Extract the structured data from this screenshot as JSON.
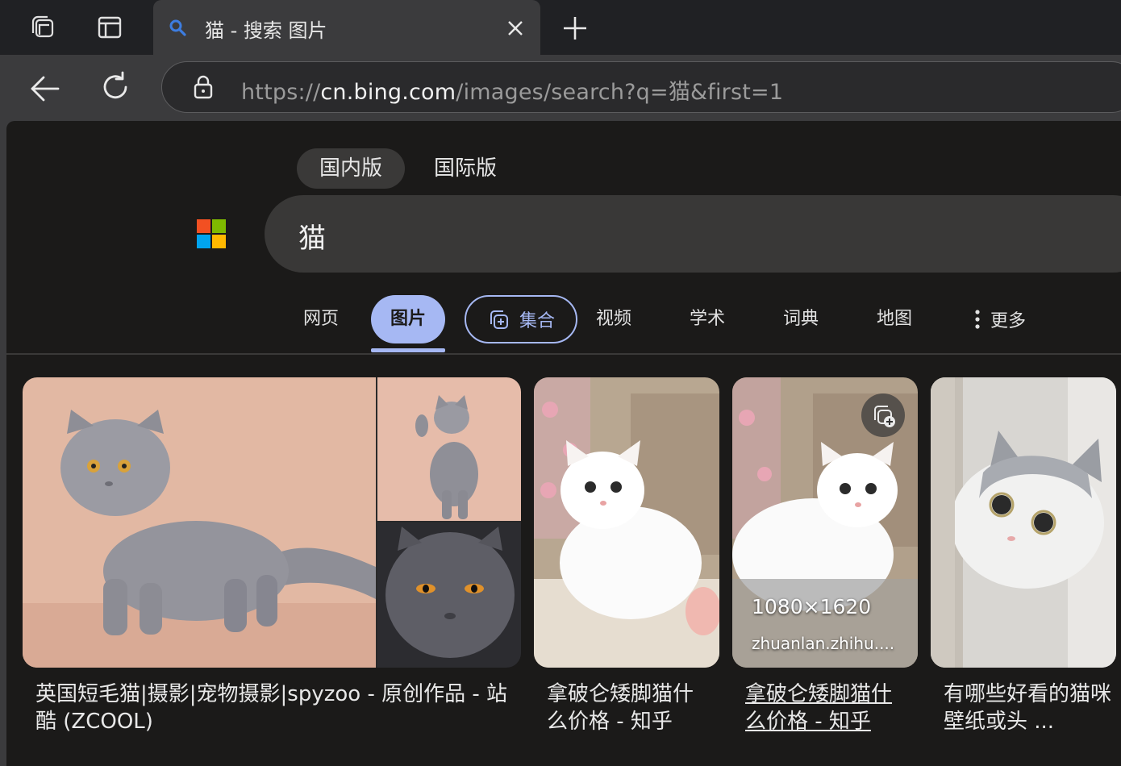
{
  "browser": {
    "tab": {
      "title": "猫 - 搜索 图片"
    },
    "address": {
      "scheme": "https://",
      "host": "cn.bing.com",
      "path": "/images/search?q=猫&first=1"
    }
  },
  "page": {
    "regions": [
      {
        "label": "国内版",
        "active": true
      },
      {
        "label": "国际版",
        "active": false
      }
    ],
    "search": {
      "query": "猫"
    },
    "nav": {
      "web": "网页",
      "images": "图片",
      "collections": "集合",
      "videos": "视频",
      "academic": "学术",
      "dictionary": "词典",
      "maps": "地图",
      "more": "更多"
    },
    "results": [
      {
        "caption": "英国短毛猫|摄影|宠物摄影|spyzoo - 原创作品 - 站酷 (ZCOOL)"
      },
      {
        "caption": "拿破仑矮脚猫什么价格 - 知乎"
      },
      {
        "caption": "拿破仑矮脚猫什么价格 - 知乎",
        "dimensions": "1080×1620",
        "source": "zhuanlan.zhihu...."
      },
      {
        "caption": "有哪些好看的猫咪壁纸或头 ..."
      }
    ]
  },
  "colors": {
    "accent": "#a6b8f3",
    "page_bg": "#1b1a19",
    "chrome_bg": "#3b3b3d"
  }
}
